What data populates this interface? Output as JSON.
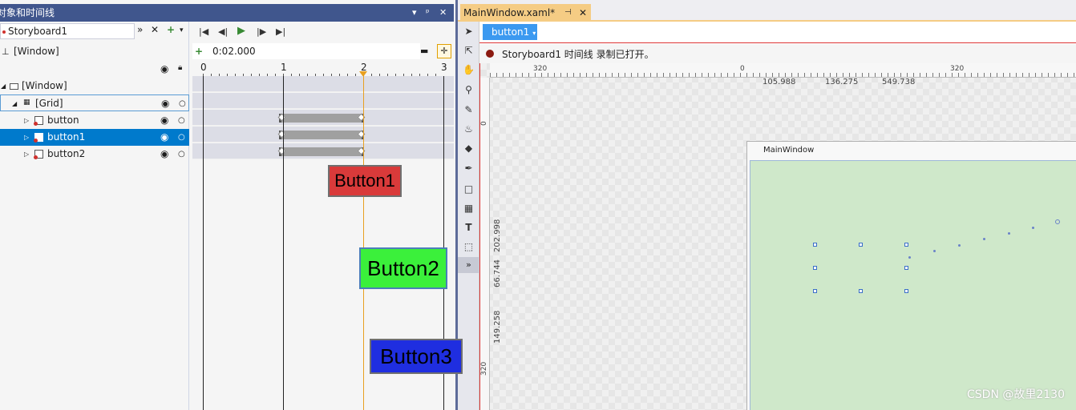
{
  "left_panel": {
    "title": "对象和时间线",
    "title_buttons": [
      "▾",
      "ᵖ",
      "✕"
    ],
    "storyboard": {
      "name": "Storyboard1",
      "icons": [
        "»",
        "✕",
        "+",
        "▾"
      ]
    },
    "root_label": "[Window]",
    "tree": [
      {
        "label": "[Window]",
        "indent": 0
      },
      {
        "label": "[Grid]",
        "indent": 1
      },
      {
        "label": "button",
        "indent": 2
      },
      {
        "label": "button1",
        "indent": 2,
        "selected": true
      },
      {
        "label": "button2",
        "indent": 2
      }
    ]
  },
  "timeline": {
    "controls": [
      "⏮",
      "◀",
      "▶",
      "▶|",
      "⏭"
    ],
    "time": "0:02.000",
    "ticks": [
      "0",
      "1",
      "2",
      "3"
    ]
  },
  "right_panel": {
    "tab_title": "MainWindow.xaml*",
    "tab_pin": "⊣",
    "tab_close": "✕",
    "breadcrumb": "button1",
    "recording_text": "Storyboard1 时间线 录制已打开。",
    "ruler": {
      "h_labels": [
        "320",
        "0",
        "320",
        "105.988",
        "136.275",
        "549.738"
      ],
      "v_labels": [
        "0",
        "202.998",
        "66.744",
        "149.258",
        "320"
      ]
    },
    "window_title": "MainWindow",
    "buttons": {
      "btn1": "Button1",
      "btn2": "Button2",
      "btn3": "Button3"
    }
  },
  "watermark": "CSDN @故里2130"
}
